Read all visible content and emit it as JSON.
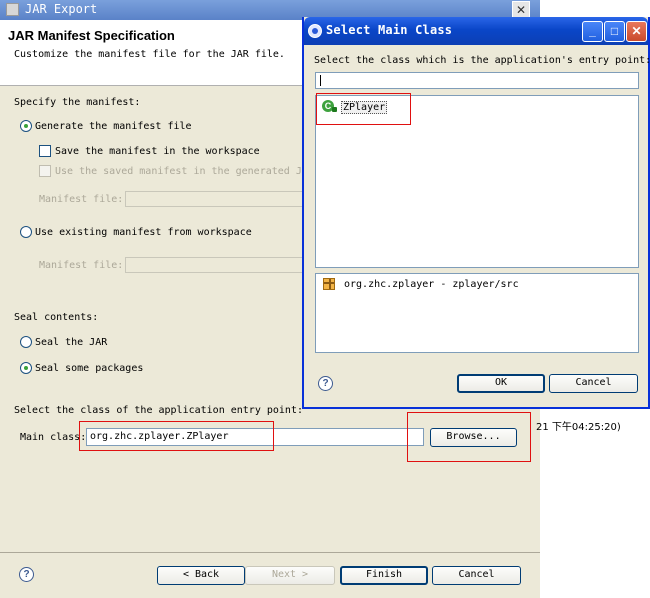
{
  "jar_export": {
    "window_title": "JAR Export",
    "header": {
      "title": "JAR Manifest Specification",
      "subtitle": "Customize the manifest file for the JAR file."
    },
    "specify_manifest_label": "Specify the manifest:",
    "generate_manifest": {
      "label": "Generate the manifest file",
      "checked": true
    },
    "save_manifest": {
      "label": "Save the manifest in the workspace",
      "checked": false
    },
    "use_saved_manifest": {
      "label": "Use the saved manifest in the generated JAR",
      "enabled": false
    },
    "manifest_file_label_1": "Manifest file:",
    "use_existing_manifest": {
      "label": "Use existing manifest from workspace",
      "checked": false
    },
    "manifest_file_label_2": "Manifest file:",
    "seal_contents_label": "Seal contents:",
    "seal_jar": {
      "label": "Seal the JAR",
      "checked": false
    },
    "seal_some_packages": {
      "label": "Seal some packages",
      "checked": true
    },
    "entry_point_label": "Select the class of the application entry point:",
    "main_class_label": "Main class:",
    "main_class_value": "org.zhc.zplayer.ZPlayer",
    "browse_button": "Browse...",
    "back_button": "< Back",
    "next_button": "Next >",
    "finish_button": "Finish",
    "cancel_button": "Cancel",
    "background_timestamp": "21 下午04:25:20)"
  },
  "select_main_class_dialog": {
    "title": "Select Main Class",
    "prompt": "Select the class which is the application's entry point:",
    "filter_value": "",
    "classes": [
      {
        "name": "ZPlayer",
        "icon": "class-icon"
      }
    ],
    "packages": [
      {
        "name": "org.zhc.zplayer - zplayer/src",
        "icon": "package-icon"
      }
    ],
    "ok_button": "OK",
    "cancel_button": "Cancel"
  }
}
